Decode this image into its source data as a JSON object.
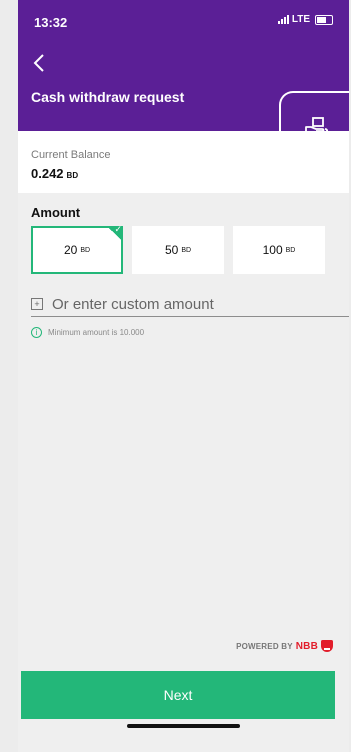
{
  "status": {
    "time": "13:32",
    "network": "LTE"
  },
  "header": {
    "title": "Cash withdraw request"
  },
  "balance": {
    "label": "Current Balance",
    "value": "0.242",
    "currency": "BD"
  },
  "amount": {
    "title": "Amount",
    "options": [
      {
        "value": "20",
        "currency": "BD",
        "selected": true
      },
      {
        "value": "50",
        "currency": "BD",
        "selected": false
      },
      {
        "value": "100",
        "currency": "BD",
        "selected": false
      }
    ],
    "custom_placeholder": "Or enter custom amount",
    "minimum_note": "Minimum amount is 10.000"
  },
  "footer": {
    "powered_by": "POWERED BY",
    "brand": "NBB",
    "next_label": "Next"
  },
  "icons": {
    "back": "back-icon",
    "cash_hand": "cash-hand-icon",
    "add": "add-icon",
    "info": "info-icon",
    "nbb": "nbb-logo-icon"
  },
  "colors": {
    "primary": "#5b1f96",
    "accent": "#23b779",
    "brand_red": "#e21d2b"
  }
}
